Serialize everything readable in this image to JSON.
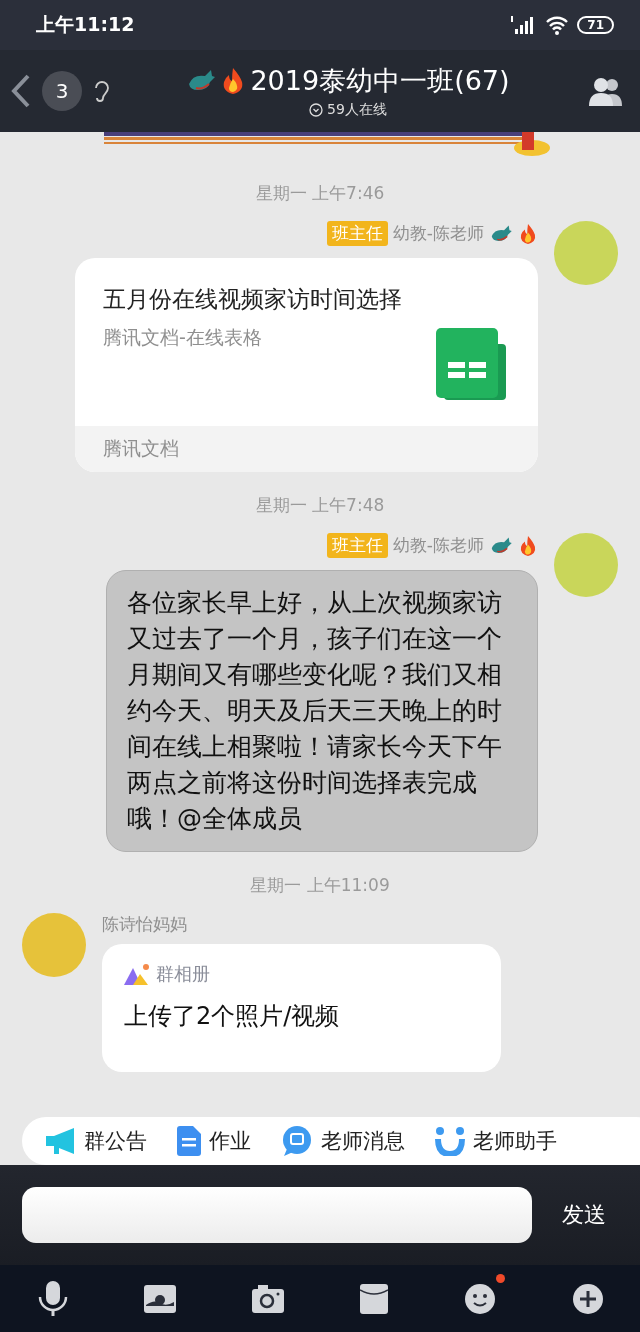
{
  "status_bar": {
    "time": "上午11:12",
    "battery": "71"
  },
  "header": {
    "unread": "3",
    "title": "2019泰幼中一班(67)",
    "online": "59人在线"
  },
  "messages": [
    {
      "kind": "time",
      "text": "星期一 上午7:46"
    },
    {
      "kind": "doc",
      "outgoing": true,
      "badge": "班主任",
      "sender": "幼教-陈老师",
      "title": "五月份在线视频家访时间选择",
      "subtitle": "腾讯文档-在线表格",
      "footer": "腾讯文档"
    },
    {
      "kind": "time",
      "text": "星期一 上午7:48"
    },
    {
      "kind": "text",
      "outgoing": true,
      "badge": "班主任",
      "sender": "幼教-陈老师",
      "text": "各位家长早上好，从上次视频家访又过去了一个月，孩子们在这一个月期间又有哪些变化呢？我们又相约今天、明天及后天三天晚上的时间在线上相聚啦！请家长今天下午两点之前将这份时间选择表完成哦！@全体成员"
    },
    {
      "kind": "time",
      "text": "星期一 上午11:09"
    },
    {
      "kind": "album",
      "outgoing": false,
      "sender": "陈诗怡妈妈",
      "source": "群相册",
      "text": "上传了2个照片/视频"
    }
  ],
  "quick_bar": [
    {
      "kind": "megaphone",
      "label": "群公告"
    },
    {
      "kind": "doc",
      "label": "作业"
    },
    {
      "kind": "teacher",
      "label": "老师消息"
    },
    {
      "kind": "helper",
      "label": "老师助手"
    }
  ],
  "composer": {
    "send": "发送"
  },
  "toolbar": [
    {
      "kind": "mic",
      "badge": false
    },
    {
      "kind": "picture",
      "badge": false
    },
    {
      "kind": "camera",
      "badge": false
    },
    {
      "kind": "envelope",
      "badge": false
    },
    {
      "kind": "emoji",
      "badge": true
    },
    {
      "kind": "plus",
      "badge": false
    }
  ]
}
